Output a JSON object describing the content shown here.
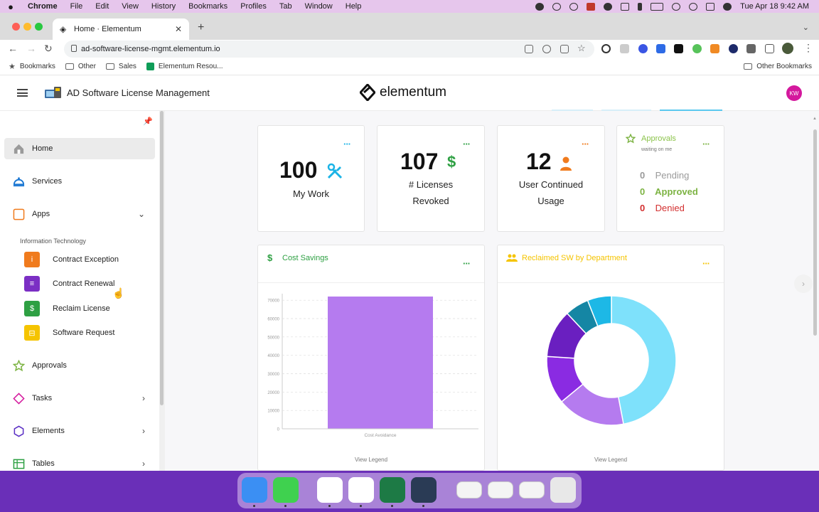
{
  "menubar": {
    "app": "Chrome",
    "items": [
      "File",
      "Edit",
      "View",
      "History",
      "Bookmarks",
      "Profiles",
      "Tab",
      "Window",
      "Help"
    ],
    "clock": "Tue Apr 18  9:42 AM"
  },
  "browser": {
    "tab_title": "Home · Elementum",
    "url": "ad-software-license-mgmt.elementum.io",
    "bookmarks": [
      "Bookmarks",
      "Other",
      "Sales",
      "Elementum Resou...",
      "Other Bookmarks"
    ]
  },
  "app": {
    "title": "AD Software License Management",
    "brand": "elementum",
    "avatar_initials": "KW"
  },
  "sidebar": {
    "nav": [
      {
        "label": "Home",
        "icon": "home-icon"
      },
      {
        "label": "Services",
        "icon": "services-icon"
      },
      {
        "label": "Apps",
        "icon": "apps-icon"
      }
    ],
    "section": "Information Technology",
    "subitems": [
      {
        "label": "Contract Exception",
        "icon": "info-icon",
        "color": "#f07b1d",
        "glyph": "i"
      },
      {
        "label": "Contract Renewal",
        "icon": "document-icon",
        "color": "#7b2fc4",
        "glyph": "≡"
      },
      {
        "label": "Reclaim License",
        "icon": "dollar-icon",
        "color": "#2ea043",
        "glyph": "$"
      },
      {
        "label": "Software Request",
        "icon": "cart-icon",
        "color": "#f5c400",
        "glyph": "⊟"
      }
    ],
    "lower": [
      {
        "label": "Approvals",
        "icon": "star-icon"
      },
      {
        "label": "Tasks",
        "icon": "diamond-icon"
      },
      {
        "label": "Elements",
        "icon": "hexagon-icon"
      },
      {
        "label": "Tables",
        "icon": "table-icon"
      }
    ]
  },
  "cards": {
    "my_work": {
      "value": "100",
      "label": "My Work",
      "icon": "tools-icon",
      "color": "#1ab3e6"
    },
    "licenses": {
      "value": "107",
      "label_line1": "# Licenses",
      "label_line2": "Revoked",
      "icon": "dollar-icon",
      "color": "#2ea043"
    },
    "usage": {
      "value": "12",
      "label_line1": "User Continued",
      "label_line2": "Usage",
      "icon": "person-icon",
      "color": "#f07b1d"
    },
    "approvals": {
      "title": "Approvals",
      "subtitle": "waiting on me",
      "rows": [
        {
          "count": "0",
          "label": "Pending",
          "color": "#9a9a9a"
        },
        {
          "count": "0",
          "label": "Approved",
          "color": "#7cb342"
        },
        {
          "count": "0",
          "label": "Denied",
          "color": "#d32f2f"
        }
      ]
    },
    "cost_savings": {
      "title": "Cost Savings",
      "legend_link": "View Legend",
      "color": "#2ea043"
    },
    "reclaimed": {
      "title": "Reclaimed SW by Department",
      "legend_link": "View Legend",
      "color": "#f5c400"
    }
  },
  "chart_data": [
    {
      "type": "bar",
      "categories": [
        "Cost Avoidance"
      ],
      "values": [
        72000
      ],
      "ylim": [
        0,
        72000
      ],
      "yticks": [
        0,
        10000,
        20000,
        30000,
        40000,
        50000,
        60000,
        70000
      ],
      "grid": true,
      "colors": [
        "#b57bef"
      ]
    },
    {
      "type": "pie",
      "donut": true,
      "values": [
        47,
        17,
        12,
        12,
        6,
        6
      ],
      "colors": [
        "#7ee1fb",
        "#b57bef",
        "#8a2be2",
        "#6a1fc0",
        "#1586a4",
        "#1db8e6"
      ]
    }
  ],
  "dock": {
    "apps": [
      {
        "name": "finder-icon",
        "color": "#3b8ff3"
      },
      {
        "name": "messages-icon",
        "color": "#3fd14f"
      },
      {
        "name": "slack-icon",
        "color": "#ffffff"
      },
      {
        "name": "chrome-icon",
        "color": "#ffffff"
      },
      {
        "name": "excel-icon",
        "color": "#1d7a45"
      },
      {
        "name": "quicktime-icon",
        "color": "#2a3b55"
      },
      {
        "name": "window-thumb-icon",
        "color": "#f4f4f4"
      },
      {
        "name": "window-thumb-icon",
        "color": "#f4f4f4"
      },
      {
        "name": "window-thumb-icon",
        "color": "#f4f4f4"
      },
      {
        "name": "trash-icon",
        "color": "#e8e8e8"
      }
    ]
  }
}
